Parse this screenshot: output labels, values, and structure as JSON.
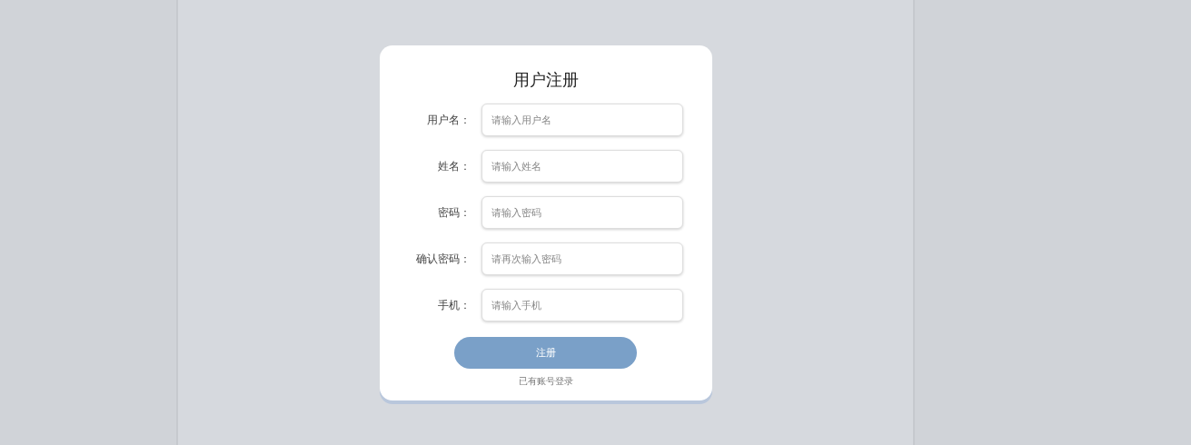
{
  "form": {
    "title": "用户注册",
    "fields": [
      {
        "label": "用户名：",
        "placeholder": "请输入用户名"
      },
      {
        "label": "姓名：",
        "placeholder": "请输入姓名"
      },
      {
        "label": "密码：",
        "placeholder": "请输入密码"
      },
      {
        "label": "确认密码：",
        "placeholder": "请再次输入密码"
      },
      {
        "label": "手机：",
        "placeholder": "请输入手机"
      }
    ],
    "submit": "注册",
    "login_link": "已有账号登录"
  }
}
